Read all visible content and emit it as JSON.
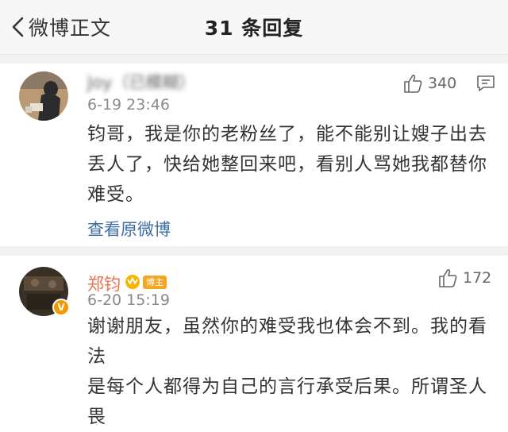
{
  "header": {
    "back_label": "微博正文",
    "title": "31 条回复"
  },
  "comments": [
    {
      "username": "Joy（已模糊）",
      "time": "6-19 23:46",
      "likes": "340",
      "body_lines": [
        "钧哥，我是你的老粉丝了，能不能别让嫂子出去",
        "丢人了，快给她整回来吧，看别人骂她我都替你",
        "难受。"
      ],
      "view_original": "查看原微博"
    },
    {
      "username": "郑钧",
      "badge": "博主",
      "time": "6-20 15:19",
      "likes": "172",
      "body_lines": [
        "谢谢朋友，虽然你的难受我也体会不到。我的看法",
        "是每个人都得为自己的言行承受后果。所谓圣人畏"
      ]
    }
  ],
  "colors": {
    "header_bg": "#f7f7f7",
    "username_orange": "#eb7350",
    "link_blue": "#3b6ea5",
    "badge_orange": "#f5a623"
  }
}
